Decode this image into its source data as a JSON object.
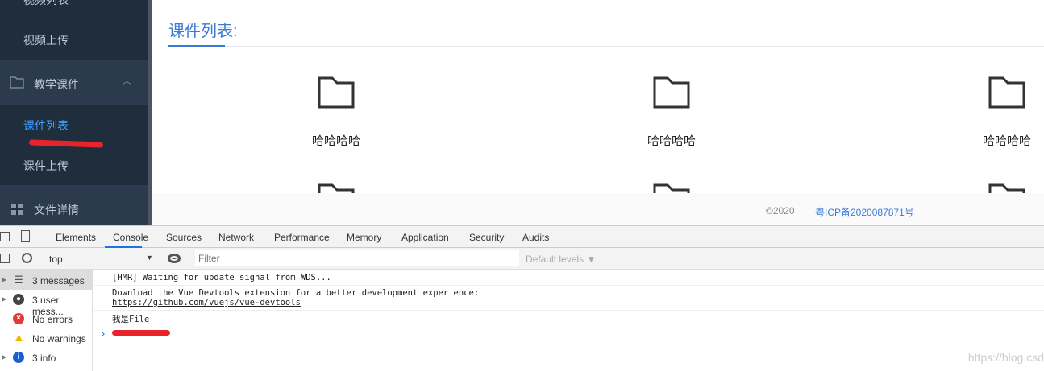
{
  "sidebar": {
    "items": [
      {
        "label": "视频列表"
      },
      {
        "label": "视频上传"
      },
      {
        "label": "教学课件"
      },
      {
        "label": "课件列表"
      },
      {
        "label": "课件上传"
      },
      {
        "label": "文件详情"
      }
    ]
  },
  "main": {
    "title": "课件列表:",
    "files": [
      "哈哈哈哈",
      "哈哈哈哈",
      "哈哈哈哈"
    ]
  },
  "footer": {
    "copyright": "©2020",
    "icp": "粤ICP备2020087871号"
  },
  "devtools": {
    "tabs": [
      "Elements",
      "Console",
      "Sources",
      "Network",
      "Performance",
      "Memory",
      "Application",
      "Security",
      "Audits"
    ],
    "context": "top",
    "filter_placeholder": "Filter",
    "levels": "Default levels ▼",
    "sidebar": [
      "3 messages",
      "3 user mess...",
      "No errors",
      "No warnings",
      "3 info"
    ],
    "logs": {
      "hmr": "[HMR] Waiting for update signal from WDS...",
      "vue": "Download the Vue Devtools extension for a better development experience:",
      "link": "https://github.com/vuejs/vue-devtools",
      "file": "我是File"
    },
    "prompt": "›"
  },
  "watermark": "https://blog.csd",
  "colors": {
    "accent": "#3a7bd5",
    "sidebar": "#1f2d3d"
  }
}
